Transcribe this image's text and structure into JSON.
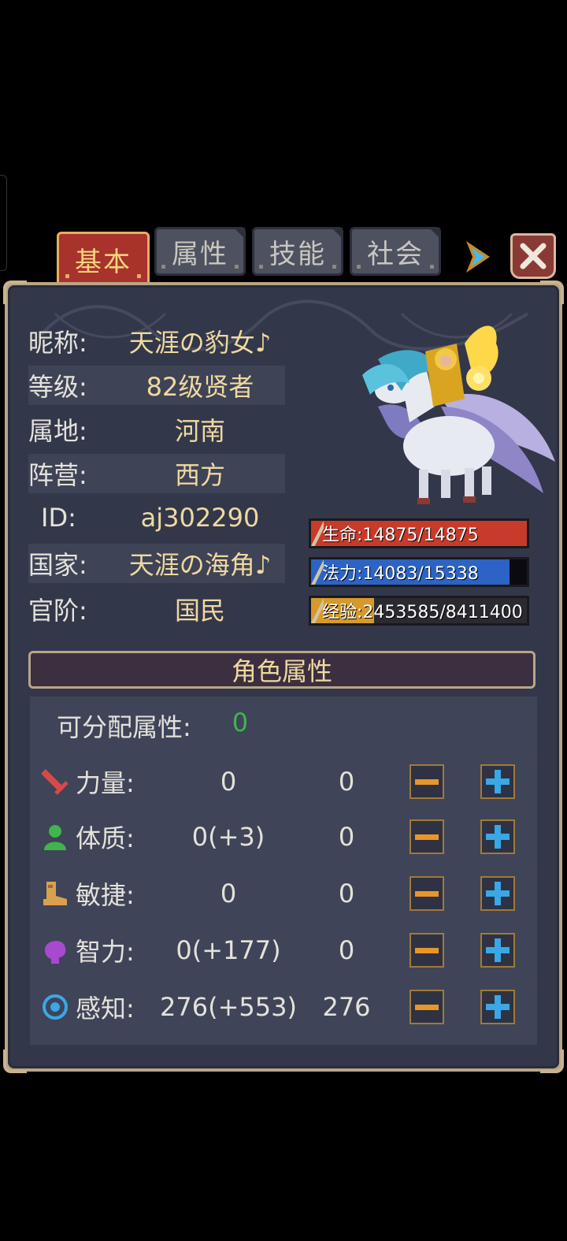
{
  "tabs": {
    "basic": "基本",
    "attributes": "属性",
    "skills": "技能",
    "social": "社会"
  },
  "info": {
    "nickname_label": "昵称:",
    "nickname": "天涯の豹女♪",
    "level_label": "等级:",
    "level": "82级贤者",
    "region_label": "属地:",
    "region": "河南",
    "camp_label": "阵营:",
    "camp": "西方",
    "id_label": "ID:",
    "id": "aj302290",
    "nation_label": "国家:",
    "nation": "天涯の海角♪",
    "rank_label": "官阶:",
    "rank": "国民"
  },
  "bars": {
    "hp": {
      "text": "生命:14875/14875",
      "current": 14875,
      "max": 14875,
      "color": "#c83a2a"
    },
    "mp": {
      "text": "法力:14083/15338",
      "current": 14083,
      "max": 15338,
      "color": "#2c63c4"
    },
    "exp": {
      "text": "经验:2453585/8411400",
      "current": 2453585,
      "max": 8411400,
      "color": "#d69a2a"
    }
  },
  "attributes_section": {
    "title": "角色属性",
    "available_label": "可分配属性:",
    "available_value": "0",
    "rows": [
      {
        "icon": "sword-icon",
        "label": "力量:",
        "base": "0",
        "allocated": "0"
      },
      {
        "icon": "person-icon",
        "label": "体质:",
        "base": "0(+3)",
        "allocated": "0"
      },
      {
        "icon": "boot-icon",
        "label": "敏捷:",
        "base": "0",
        "allocated": "0"
      },
      {
        "icon": "brain-icon",
        "label": "智力:",
        "base": "0(+177)",
        "allocated": "0"
      },
      {
        "icon": "eye-icon",
        "label": "感知:",
        "base": "276(+553)",
        "allocated": "276"
      }
    ]
  },
  "colors": {
    "accent_gold": "#f0d9a0",
    "positive": "#3fb54a",
    "tab_active": "#a8322c"
  }
}
